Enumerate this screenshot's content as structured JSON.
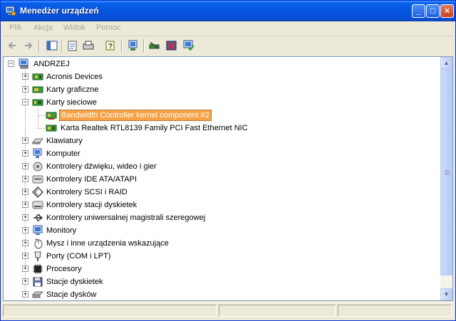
{
  "window": {
    "title": "Menedżer urządzeń",
    "controls": {
      "minimize": "_",
      "maximize": "□",
      "close": "×"
    }
  },
  "menu": {
    "items": [
      "Plik",
      "Akcja",
      "Widok",
      "Pomoc"
    ]
  },
  "toolbar": {
    "icons": [
      "back-icon",
      "forward-icon",
      "show-hide-console-tree-icon",
      "properties-icon",
      "print-icon",
      "help-icon",
      "computer-scan-icon",
      "update-driver-icon",
      "uninstall-icon",
      "enable-device-icon"
    ]
  },
  "tree": {
    "root": "ANDRZEJ",
    "items": [
      {
        "label": "Acronis Devices",
        "icon": "board-icon",
        "expanded": false
      },
      {
        "label": "Karty graficzne",
        "icon": "display-adapter-icon",
        "expanded": false
      },
      {
        "label": "Karty sieciowe",
        "icon": "network-adapter-icon",
        "expanded": true,
        "children": [
          {
            "label": "Bandwidth Controller kernel component #2",
            "icon": "network-card-icon",
            "selected": true
          },
          {
            "label": "Karta Realtek RTL8139 Family PCI Fast Ethernet NIC",
            "icon": "network-card-icon",
            "selected": false
          }
        ]
      },
      {
        "label": "Klawiatury",
        "icon": "keyboard-icon",
        "expanded": false
      },
      {
        "label": "Komputer",
        "icon": "computer-icon",
        "expanded": false
      },
      {
        "label": "Kontrolery dźwięku, wideo i gier",
        "icon": "sound-icon",
        "expanded": false
      },
      {
        "label": "Kontrolery IDE ATA/ATAPI",
        "icon": "ide-controller-icon",
        "expanded": false
      },
      {
        "label": "Kontrolery SCSI i RAID",
        "icon": "scsi-icon",
        "expanded": false
      },
      {
        "label": "Kontrolery stacji dyskietek",
        "icon": "floppy-controller-icon",
        "expanded": false
      },
      {
        "label": "Kontrolery uniwersalnej magistrali szeregowej",
        "icon": "usb-icon",
        "expanded": false
      },
      {
        "label": "Monitory",
        "icon": "monitor-icon",
        "expanded": false
      },
      {
        "label": "Mysz i inne urządzenia wskazujące",
        "icon": "mouse-icon",
        "expanded": false
      },
      {
        "label": "Porty (COM i LPT)",
        "icon": "port-icon",
        "expanded": false
      },
      {
        "label": "Procesory",
        "icon": "processor-icon",
        "expanded": false
      },
      {
        "label": "Stacje dyskietek",
        "icon": "floppy-drive-icon",
        "expanded": false
      },
      {
        "label": "Stacje dysków",
        "icon": "disk-drive-icon",
        "expanded": false
      }
    ]
  },
  "colors": {
    "titlebar": "#0a5fe8",
    "selection": "#f7a245",
    "chrome": "#ece9d8"
  }
}
